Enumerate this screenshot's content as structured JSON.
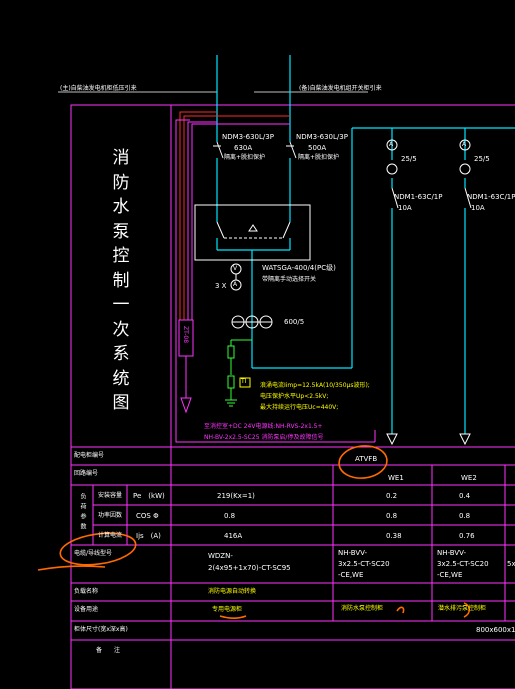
{
  "title_vertical": "消防水泵控制一次系统图",
  "top_labels": {
    "left": "(主)自柴油发电机柜低压引来",
    "right": "(备)自柴油发电机组开关柜引来"
  },
  "main_breakers": {
    "left": {
      "model": "NDM3-630L/3P",
      "rating": "630A",
      "desc": "隔离+脱扣保护"
    },
    "right": {
      "model": "NDM3-630L/3P",
      "rating": "500A",
      "desc": "隔离+脱扣保护"
    }
  },
  "ats": {
    "model": "WATSGA-400/4(PC级)",
    "desc": "带隔离手动选择开关"
  },
  "meters": {
    "ammeter_label": "3 X"
  },
  "ct": {
    "ratio": "600/5"
  },
  "zt": {
    "label": "ZT-08"
  },
  "branch_ct": {
    "ratio": "25/5"
  },
  "branch_breakers": {
    "model": "NDM1-63C/1P",
    "rating": "10A"
  },
  "spd_label": "TI",
  "spd_notes": [
    "浪涌电流Iimp=12.5kA(10/350μs波形);",
    "电压保护水平Up<2.5kV;",
    "最大持续运行电压Uc=440V;"
  ],
  "magenta_notes": [
    "至消控室+DC 24V电源线:NH-RVS-2x1.5+",
    "NH-BV-2x2.5-SC25 消防泵启/停及故障信号"
  ],
  "table": {
    "rows": {
      "cabinet_no": "配电柜编号",
      "circuit_no": "回路编号",
      "load_group_label": "负荷参数",
      "load_power": "安装容量",
      "pe_unit": "Pe　(kW)",
      "power_factor_label": "功率因数",
      "cos_phi": "COS Φ",
      "calc_current_label": "计算电流",
      "ijs_unit": "Ijs　(A)",
      "cable_spec": "电缆/导线型号",
      "load_name": "负载名称",
      "device_use": "设备用途",
      "cabinet_size": "柜体尺寸(宽x深x高)",
      "remarks": "备　　注"
    },
    "atv_label": "ATVFB",
    "main_col": {
      "pe": "219(Kx=1)",
      "cos": "0.8",
      "ijs": "416A",
      "cable": [
        "WDZN-",
        "2(4x95+1x70)-CT-SC95"
      ],
      "load_name": "消防电源自动转换",
      "device_use": "专用电源柜"
    },
    "circuits": [
      {
        "id": "WE1",
        "pe": "0.2",
        "cos": "0.8",
        "ijs": "0.38",
        "cable": [
          "NH-BVV-",
          "3x2.5-CT-SC20",
          "-CE,WE"
        ],
        "load_name": "消防水泵控制柜"
      },
      {
        "id": "WE2",
        "pe": "0.4",
        "cos": "0.8",
        "ijs": "0.76",
        "cable": [
          "NH-BVV-",
          "3x2.5-CT-SC20",
          "-CE,WE"
        ],
        "load_name": "潜水排污泵控制柜"
      },
      {
        "id": "",
        "pe": "",
        "cos": "",
        "ijs": "",
        "cable": [
          "",
          "5x",
          ""
        ],
        "load_name": ""
      }
    ],
    "cabinet_size_value": "800x600x1800"
  },
  "colors": {
    "background": "#000000",
    "frame": "#ff33ff",
    "feeder": "#00e5ff",
    "neutral_red": "#ff2a2a",
    "label_yellow": "#ffff00",
    "ground_green": "#33ff33",
    "annotation": "#ff6a00"
  }
}
